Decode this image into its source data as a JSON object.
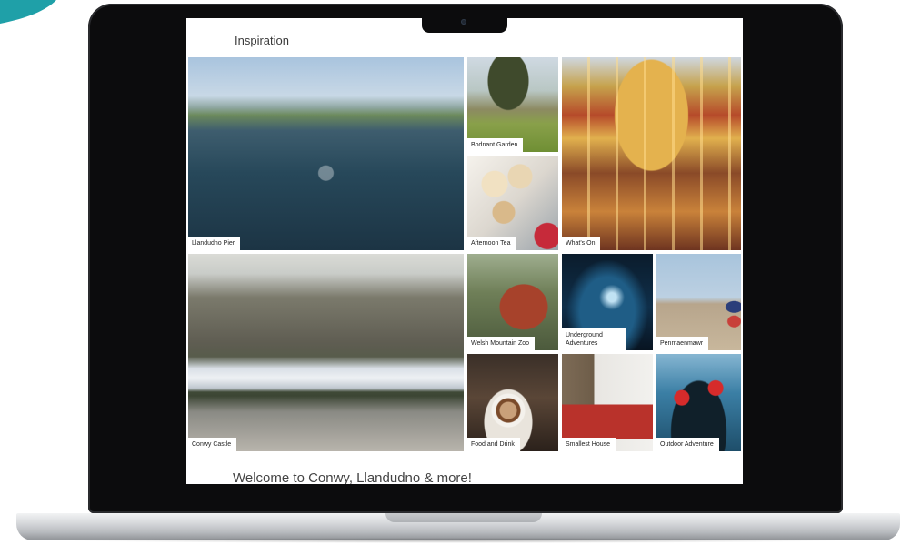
{
  "colors": {
    "accent": "#1fa0a8",
    "lid": "#0c0c0d",
    "screen_bg": "#ffffff",
    "label_bg": "#ffffff"
  },
  "page": {
    "title": "Inspiration",
    "welcome": "Welcome to Conwy, Llandudno & more!"
  },
  "tiles": [
    {
      "label": "Llandudno Pier",
      "image": "aerial pier over bay"
    },
    {
      "label": "Bodnant Garden",
      "image": "tree and garden house"
    },
    {
      "label": "Afternoon Tea",
      "image": "scones and tea"
    },
    {
      "label": "What's On",
      "image": "carousel ride"
    },
    {
      "label": "Conwy Castle",
      "image": "castle and bridge"
    },
    {
      "label": "Welsh Mountain Zoo",
      "image": "red panda"
    },
    {
      "label": "Underground Adventures",
      "image": "cave zipline"
    },
    {
      "label": "Penmaenmawr",
      "image": "beach walkers"
    },
    {
      "label": "Food and Drink",
      "image": "latte coffee cup"
    },
    {
      "label": "Smallest House",
      "image": "tiny red house"
    },
    {
      "label": "Outdoor Adventure",
      "image": "coasteering group"
    }
  ]
}
